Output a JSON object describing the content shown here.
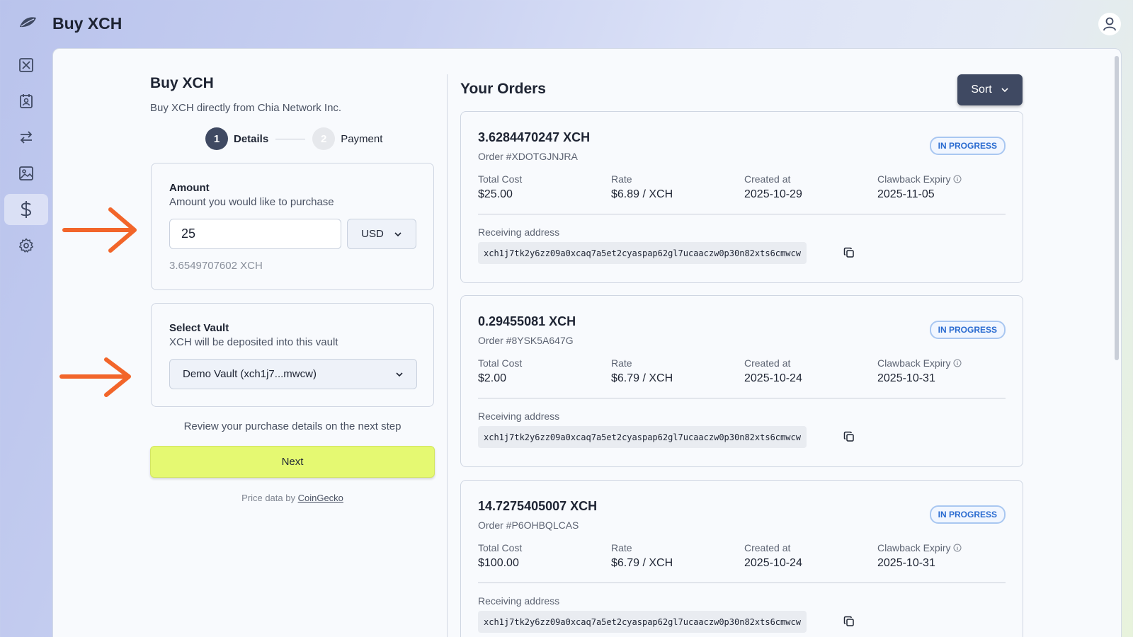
{
  "app": {
    "title": "Buy XCH"
  },
  "sidebar": {
    "items": [
      {
        "icon": "xch-icon"
      },
      {
        "icon": "contacts-icon"
      },
      {
        "icon": "transfer-icon"
      },
      {
        "icon": "image-icon"
      },
      {
        "icon": "dollar-icon",
        "active": true
      },
      {
        "icon": "gear-icon"
      }
    ]
  },
  "buy": {
    "title": "Buy XCH",
    "subtitle": "Buy XCH directly from Chia Network Inc.",
    "steps": [
      {
        "num": "1",
        "label": "Details"
      },
      {
        "num": "2",
        "label": "Payment"
      }
    ],
    "amount": {
      "title": "Amount",
      "subtitle": "Amount you would like to purchase",
      "value": "25",
      "currency": "USD",
      "converted": "3.6549707602 XCH"
    },
    "vault": {
      "title": "Select Vault",
      "subtitle": "XCH will be deposited into this vault",
      "selected": "Demo Vault (xch1j7...mwcw)"
    },
    "review_text": "Review your purchase details on the next step",
    "next_label": "Next",
    "price_prefix": "Price data by",
    "price_link": "CoinGecko"
  },
  "orders": {
    "title": "Your Orders",
    "sort_label": "Sort",
    "labels": {
      "total_cost": "Total Cost",
      "rate": "Rate",
      "created_at": "Created at",
      "clawback": "Clawback Expiry",
      "receiving": "Receiving address"
    },
    "items": [
      {
        "amount": "3.6284470247 XCH",
        "order_id": "Order #XDOTGJNJRA",
        "status": "IN PROGRESS",
        "total_cost": "$25.00",
        "rate": "$6.89 / XCH",
        "created_at": "2025-10-29",
        "clawback": "2025-11-05",
        "address": "xch1j7tk2y6zz09a0xcaq7a5et2cyaspap62gl7ucaaczw0p30n82xts6cmwcw"
      },
      {
        "amount": "0.29455081 XCH",
        "order_id": "Order #8YSK5A647G",
        "status": "IN PROGRESS",
        "total_cost": "$2.00",
        "rate": "$6.79 / XCH",
        "created_at": "2025-10-24",
        "clawback": "2025-10-31",
        "address": "xch1j7tk2y6zz09a0xcaq7a5et2cyaspap62gl7ucaaczw0p30n82xts6cmwcw"
      },
      {
        "amount": "14.7275405007 XCH",
        "order_id": "Order #P6OHBQLCAS",
        "status": "IN PROGRESS",
        "total_cost": "$100.00",
        "rate": "$6.79 / XCH",
        "created_at": "2025-10-24",
        "clawback": "2025-10-31",
        "address": "xch1j7tk2y6zz09a0xcaq7a5et2cyaspap62gl7ucaaczw0p30n82xts6cmwcw"
      }
    ]
  },
  "colors": {
    "accent": "#3f4962",
    "next_button": "#e5f972",
    "badge": "#2a6bd0",
    "annotation_arrow": "#f2652a"
  }
}
